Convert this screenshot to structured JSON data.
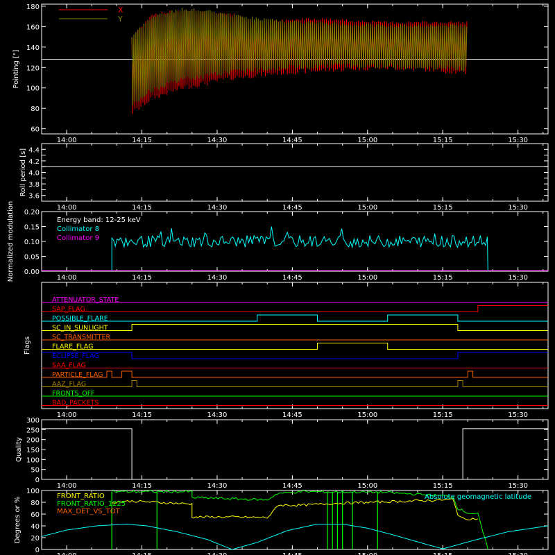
{
  "time_ticks": [
    "14:00",
    "14:15",
    "14:30",
    "14:45",
    "15:00",
    "15:15",
    "15:30"
  ],
  "chart_data": [
    {
      "type": "line",
      "ylabel": "Pointing [\"]",
      "ylim": [
        55,
        182
      ],
      "yticks": [
        60,
        80,
        100,
        120,
        140,
        160,
        180
      ],
      "legend": [
        {
          "name": "X",
          "color": "#ff0000"
        },
        {
          "name": "Y",
          "color": "#808000"
        }
      ],
      "reference_line": 128,
      "x_range": [
        "14:13",
        "15:20"
      ],
      "series": [
        {
          "name": "X",
          "color": "#ff0000",
          "upper": [
            [
              0,
              150
            ],
            [
              4,
              172
            ],
            [
              10,
              176
            ],
            [
              20,
              172
            ],
            [
              25,
              164
            ],
            [
              35,
              168
            ],
            [
              40,
              167
            ],
            [
              50,
              164
            ],
            [
              67,
              164
            ]
          ],
          "lower": [
            [
              0,
              75
            ],
            [
              4,
              90
            ],
            [
              10,
              100
            ],
            [
              20,
              110
            ],
            [
              30,
              115
            ],
            [
              40,
              118
            ],
            [
              50,
              120
            ],
            [
              60,
              118
            ],
            [
              67,
              114
            ]
          ]
        },
        {
          "name": "Y",
          "color": "#808000",
          "upper": [
            [
              0,
              150
            ],
            [
              4,
              170
            ],
            [
              10,
              177
            ],
            [
              14,
              176
            ],
            [
              20,
              171
            ],
            [
              30,
              165
            ],
            [
              40,
              163
            ],
            [
              50,
              161
            ],
            [
              67,
              161
            ]
          ],
          "lower": [
            [
              0,
              83
            ],
            [
              4,
              98
            ],
            [
              10,
              108
            ],
            [
              20,
              116
            ],
            [
              30,
              120
            ],
            [
              40,
              122
            ],
            [
              50,
              121
            ],
            [
              60,
              120
            ],
            [
              67,
              119
            ]
          ]
        }
      ]
    },
    {
      "type": "line",
      "ylabel": "Roll period [s]",
      "ylim": [
        3.5,
        4.5
      ],
      "yticks": [
        3.6,
        3.7,
        3.8,
        3.9,
        4.0,
        4.1,
        4.2,
        4.3,
        4.4
      ],
      "yticklabels": [
        "3.6",
        "",
        "3.8",
        "",
        "4.0",
        "",
        "4.2",
        "",
        "4.4"
      ],
      "value": 4.1
    },
    {
      "type": "line",
      "ylabel": "Normalized modulation",
      "ylim": [
        0,
        0.2
      ],
      "yticks": [
        0,
        0.05,
        0.1,
        0.15,
        0.2
      ],
      "yticklabels": [
        "0.00",
        "0.05",
        "0.10",
        "0.15",
        "0.20"
      ],
      "annotation": "Energy band: 12-25 keV",
      "legend": [
        {
          "name": "Collimator 8",
          "color": "#00ffff"
        },
        {
          "name": "Collimator 9",
          "color": "#ff00ff"
        }
      ],
      "series": [
        {
          "name": "Collimator 8",
          "color": "#00ffff",
          "start": "14:09",
          "end": "15:24",
          "mean": 0.1,
          "spread": 0.02
        },
        {
          "name": "Collimator 9",
          "color": "#ff00ff",
          "value": 0
        }
      ]
    },
    {
      "type": "line",
      "ylabel": "Flags",
      "flags": [
        {
          "name": "ATTENUATOR_STATE",
          "color": "#ff00ff",
          "segments": []
        },
        {
          "name": "SAP_FLAG",
          "color": "#ff0000",
          "segments": [
            [
              "15:22",
              "15:36"
            ]
          ]
        },
        {
          "name": "POSSIBLE_FLARE",
          "color": "#00ffff",
          "segments": [
            [
              "14:38",
              "14:50"
            ],
            [
              "15:04",
              "15:18"
            ]
          ]
        },
        {
          "name": "SC_IN_SUNLIGHT",
          "color": "#ffff00",
          "segments": [
            [
              "14:13",
              "15:18"
            ]
          ]
        },
        {
          "name": "SC_TRANSMITTER",
          "color": "#ff6000",
          "segments": []
        },
        {
          "name": "FLARE_FLAG",
          "color": "#ffff00",
          "segments": [
            [
              "14:50",
              "15:04"
            ]
          ]
        },
        {
          "name": "ECLIPSE_FLAG",
          "color": "#0000ff",
          "segments": [
            [
              "13:55",
              "14:13"
            ],
            [
              "15:18",
              "15:36"
            ]
          ]
        },
        {
          "name": "SAA_FLAG",
          "color": "#ff0000",
          "segments": []
        },
        {
          "name": "PARTICLE_FLAG",
          "color": "#ff6000",
          "segments": [
            [
              "14:08",
              "14:09"
            ],
            [
              "14:11",
              "14:13"
            ],
            [
              "15:20",
              "15:21"
            ]
          ]
        },
        {
          "name": "AAZ_FLAG",
          "color": "#a08000",
          "segments": [
            [
              "14:13",
              "14:14"
            ],
            [
              "15:18",
              "15:19"
            ]
          ]
        },
        {
          "name": "FRONTS_OFF",
          "color": "#00ff00",
          "segments": []
        },
        {
          "name": "BAD_PACKETS",
          "color": "#ff0000",
          "segments": []
        }
      ]
    },
    {
      "type": "line",
      "ylabel": "Quality",
      "ylim": [
        0,
        300
      ],
      "yticks": [
        0,
        50,
        100,
        150,
        200,
        250,
        300
      ],
      "series": [
        {
          "name": "",
          "color": "#ffffff",
          "points": [
            [
              "13:55",
              255
            ],
            [
              "14:13",
              255
            ],
            [
              "14:13",
              0
            ],
            [
              "15:19",
              0
            ],
            [
              "15:19",
              255
            ],
            [
              "15:36",
              255
            ]
          ]
        }
      ]
    },
    {
      "type": "line",
      "ylabel": "Degrees or %",
      "ylim": [
        0,
        100
      ],
      "yticks": [
        0,
        20,
        40,
        60,
        80,
        100
      ],
      "legend": [
        {
          "name": "FRONT_RATIO",
          "color": "#ffff00"
        },
        {
          "name": "FRONT_RATIO_1225",
          "color": "#00ff00"
        },
        {
          "name": "MAX_DET_VS_TOT",
          "color": "#ff6000"
        }
      ],
      "annotation": "Absolute geomagnetic latitude",
      "series": [
        {
          "name": "FRONT_RATIO",
          "color": "#ffff00",
          "points": [
            [
              "14:09",
              80
            ],
            [
              "14:13",
              82
            ],
            [
              "14:25",
              77
            ],
            [
              "14:25",
              55
            ],
            [
              "14:33",
              55
            ],
            [
              "14:40",
              54
            ],
            [
              "14:41",
              62
            ],
            [
              "14:42",
              75
            ],
            [
              "14:47",
              75
            ],
            [
              "14:53",
              78
            ],
            [
              "15:12",
              83
            ],
            [
              "15:17",
              85
            ],
            [
              "15:18",
              60
            ],
            [
              "15:19",
              52
            ],
            [
              "15:22",
              52
            ]
          ]
        },
        {
          "name": "FRONT_RATIO_1225",
          "color": "#00ff00",
          "points": [
            [
              "14:09",
              98
            ],
            [
              "14:25",
              98
            ],
            [
              "14:25",
              88
            ],
            [
              "14:33",
              86
            ],
            [
              "14:40",
              84
            ],
            [
              "14:42",
              95
            ],
            [
              "14:47",
              98
            ],
            [
              "15:03",
              97
            ],
            [
              "15:13",
              92
            ],
            [
              "15:17",
              90
            ],
            [
              "15:18",
              70
            ],
            [
              "15:20",
              62
            ],
            [
              "15:22",
              60
            ],
            [
              "15:23",
              30
            ],
            [
              "15:24",
              0
            ]
          ]
        },
        {
          "name": "Absolute geomagnetic latitude",
          "color": "#00ffff",
          "points": [
            [
              "13:55",
              22
            ],
            [
              "14:00",
              33
            ],
            [
              "14:06",
              40
            ],
            [
              "14:12",
              43
            ],
            [
              "14:16",
              40
            ],
            [
              "14:22",
              30
            ],
            [
              "14:28",
              17
            ],
            [
              "14:33",
              0
            ],
            [
              "14:38",
              12
            ],
            [
              "14:44",
              32
            ],
            [
              "14:50",
              43
            ],
            [
              "14:55",
              43
            ],
            [
              "15:00",
              36
            ],
            [
              "15:05",
              25
            ],
            [
              "15:12",
              8
            ],
            [
              "15:15",
              1
            ],
            [
              "15:21",
              15
            ],
            [
              "15:28",
              30
            ],
            [
              "15:36",
              40
            ]
          ]
        }
      ]
    }
  ]
}
